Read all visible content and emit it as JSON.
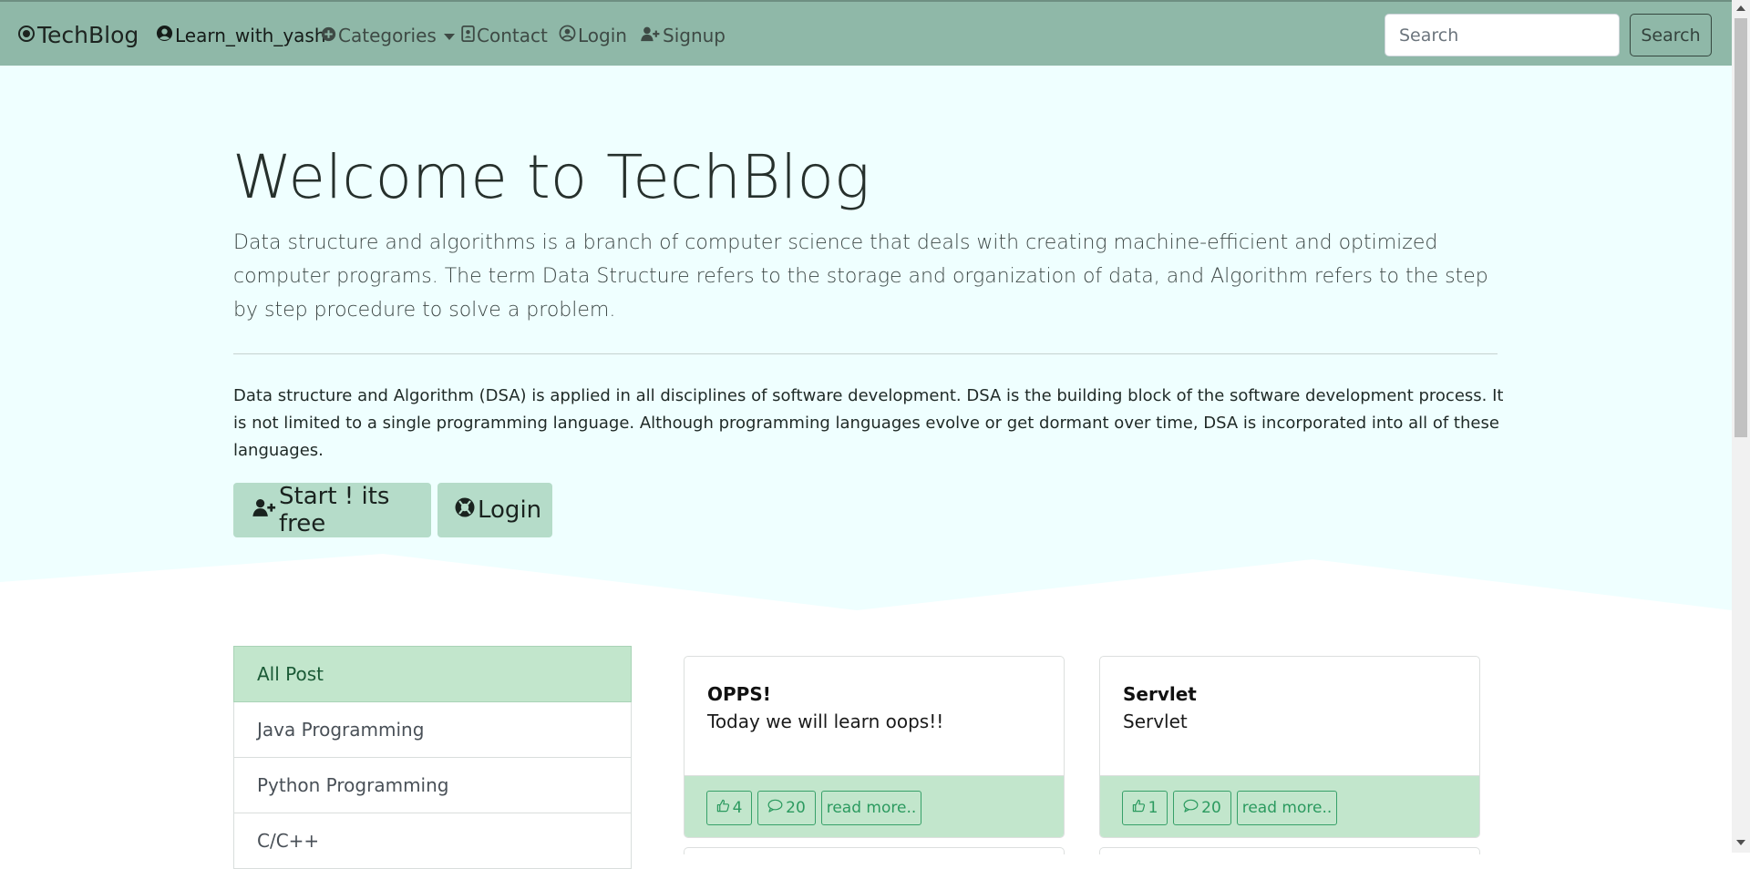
{
  "navbar": {
    "brand": "TechBlog",
    "items": [
      {
        "label": "Learn_with_yash",
        "icon": "user-circle-icon"
      },
      {
        "label": "Categories",
        "icon": "plus-circle-icon"
      },
      {
        "label": "Contact",
        "icon": "address-book-icon"
      },
      {
        "label": "Login",
        "icon": "user-circle-icon"
      },
      {
        "label": "Signup",
        "icon": "user-plus-icon"
      }
    ],
    "search_placeholder": "Search",
    "search_button": "Search"
  },
  "hero": {
    "title": "Welcome to TechBlog",
    "lead": "Data structure and algorithms is a branch of computer science that deals with creating machine-efficient and optimized computer programs. The term Data Structure refers to the storage and organization of data, and Algorithm refers to the step by step procedure to solve a problem.",
    "text": "Data structure and Algorithm (DSA) is applied in all disciplines of software development. DSA is the building block of the software development process. It is not limited to a single programming language. Although programming languages evolve or get dormant over time, DSA is incorporated into all of these languages.",
    "start_button": "Start ! its free",
    "login_button": "Login"
  },
  "sidebar": {
    "items": [
      {
        "label": "All Post",
        "active": true
      },
      {
        "label": "Java Programming",
        "active": false
      },
      {
        "label": "Python Programming",
        "active": false
      },
      {
        "label": "C/C++",
        "active": false
      }
    ]
  },
  "posts": [
    {
      "title": "OPPS!",
      "text": "Today we will learn oops!!",
      "likes": "4",
      "comments": "20",
      "read_more": "read more.."
    },
    {
      "title": "Servlet",
      "text": "Servlet",
      "likes": "1",
      "comments": "20",
      "read_more": "read more.."
    }
  ],
  "colors": {
    "navbar": "#8fb8a8",
    "hero_background": "#efffff",
    "accent_green": "#c2e6cc",
    "button_outline": "#37a069"
  }
}
